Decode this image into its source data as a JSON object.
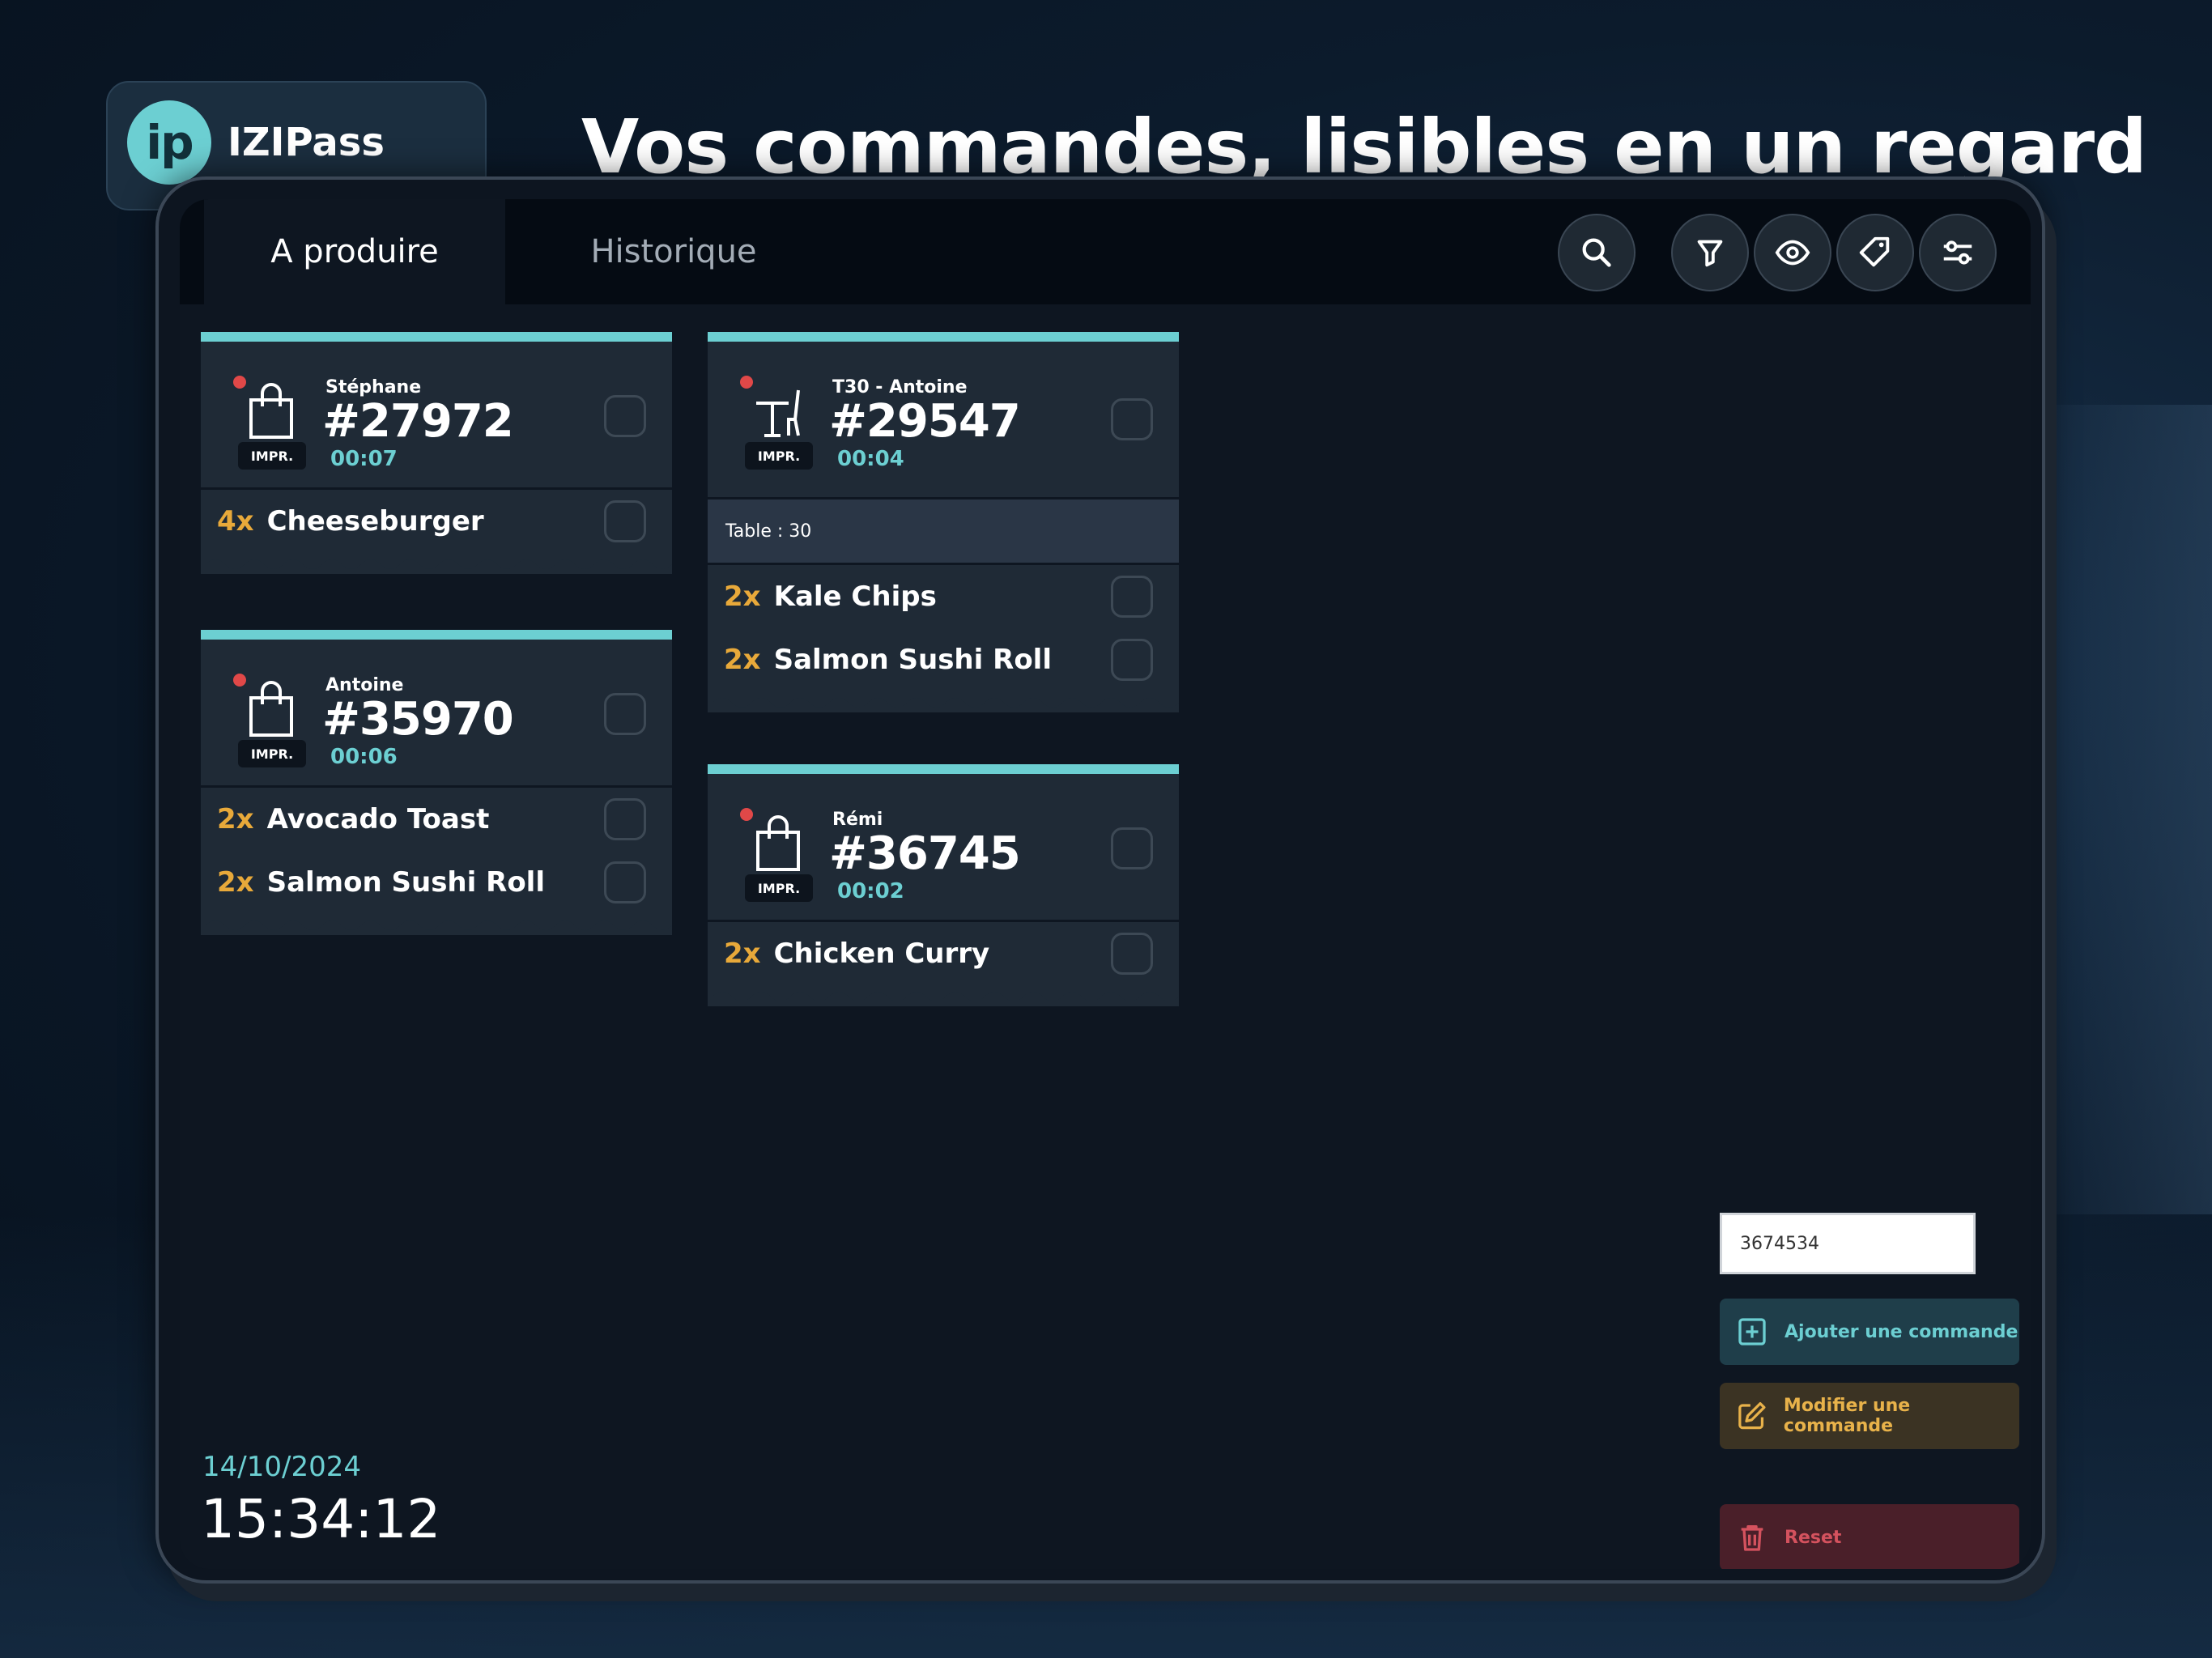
{
  "brand": {
    "logo_text": "ip",
    "name": "IZIPass"
  },
  "headline": "Vos commandes, lisibles en un regard",
  "tabs": [
    {
      "label": "A produire",
      "active": true
    },
    {
      "label": "Historique",
      "active": false
    }
  ],
  "toolbar_icons": [
    "search-icon",
    "filter-icon",
    "eye-icon",
    "tag-icon",
    "sliders-icon"
  ],
  "orders": [
    {
      "customer": "Stéphane",
      "number": "#27972",
      "elapsed": "00:07",
      "badge": "IMPR.",
      "type": "takeaway",
      "items": [
        {
          "qty": "4x",
          "name": "Cheeseburger"
        }
      ]
    },
    {
      "customer": "Antoine",
      "number": "#35970",
      "elapsed": "00:06",
      "badge": "IMPR.",
      "type": "takeaway",
      "items": [
        {
          "qty": "2x",
          "name": "Avocado Toast"
        },
        {
          "qty": "2x",
          "name": "Salmon Sushi Roll"
        }
      ]
    },
    {
      "customer": "T30 - Antoine",
      "number": "#29547",
      "elapsed": "00:04",
      "badge": "IMPR.",
      "type": "table",
      "note": "Table : 30",
      "items": [
        {
          "qty": "2x",
          "name": "Kale Chips"
        },
        {
          "qty": "2x",
          "name": "Salmon Sushi Roll"
        }
      ]
    },
    {
      "customer": "Rémi",
      "number": "#36745",
      "elapsed": "00:02",
      "badge": "IMPR.",
      "type": "takeaway",
      "items": [
        {
          "qty": "2x",
          "name": "Chicken Curry"
        }
      ]
    }
  ],
  "clock": {
    "date": "14/10/2024",
    "time": "15:34:12"
  },
  "command_input": {
    "value": "3674534"
  },
  "actions": {
    "add": "Ajouter une commande",
    "modify": "Modifier une commande",
    "reset": "Reset"
  },
  "colors": {
    "accent": "#6ccfd2",
    "qty": "#e8a93a",
    "alert_dot": "#e04848",
    "reset": "#d4525e"
  }
}
